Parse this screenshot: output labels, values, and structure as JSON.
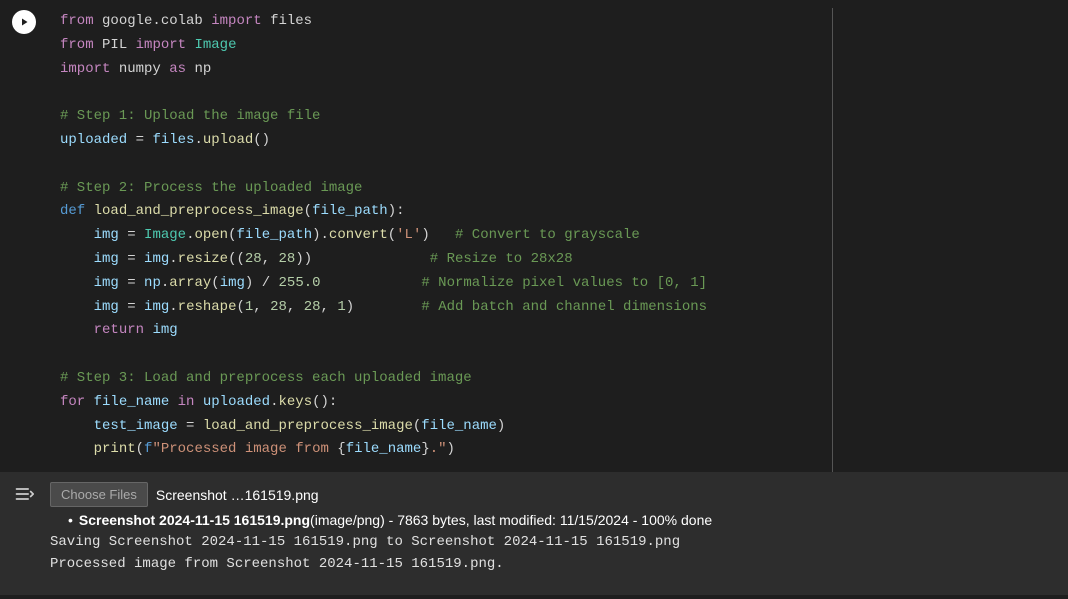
{
  "code": {
    "lines_html": [
      "<span class='kw'>from</span> <span class='mod'>google.colab</span> <span class='kw'>import</span> <span class='mod'>files</span>",
      "<span class='kw'>from</span> <span class='mod'>PIL</span> <span class='kw'>import</span> <span class='cls'>Image</span>",
      "<span class='kw'>import</span> <span class='mod'>numpy</span> <span class='kw'>as</span> <span class='mod'>np</span>",
      "",
      "<span class='cmt'># Step 1: Upload the image file</span>",
      "<span class='var'>uploaded</span> <span class='op'>=</span> <span class='var'>files</span><span class='punc'>.</span><span class='fn-call'>upload</span><span class='punc'>()</span>",
      "",
      "<span class='cmt'># Step 2: Process the uploaded image</span>",
      "<span class='kw-def'>def</span> <span class='fn'>load_and_preprocess_image</span><span class='punc'>(</span><span class='param'>file_path</span><span class='punc'>):</span>",
      "    <span class='var'>img</span> <span class='op'>=</span> <span class='cls'>Image</span><span class='punc'>.</span><span class='fn-call'>open</span><span class='punc'>(</span><span class='var'>file_path</span><span class='punc'>).</span><span class='fn-call'>convert</span><span class='punc'>(</span><span class='str'>'L'</span><span class='punc'>)</span>   <span class='cmt'># Convert to grayscale</span>",
      "    <span class='var'>img</span> <span class='op'>=</span> <span class='var'>img</span><span class='punc'>.</span><span class='fn-call'>resize</span><span class='punc'>((</span><span class='num'>28</span><span class='punc'>,</span> <span class='num'>28</span><span class='punc'>))</span>              <span class='cmt'># Resize to 28x28</span>",
      "    <span class='var'>img</span> <span class='op'>=</span> <span class='var'>np</span><span class='punc'>.</span><span class='fn-call'>array</span><span class='punc'>(</span><span class='var'>img</span><span class='punc'>)</span> <span class='op'>/</span> <span class='num'>255.0</span>            <span class='cmt'># Normalize pixel values to [0, 1]</span>",
      "    <span class='var'>img</span> <span class='op'>=</span> <span class='var'>img</span><span class='punc'>.</span><span class='fn-call'>reshape</span><span class='punc'>(</span><span class='num'>1</span><span class='punc'>,</span> <span class='num'>28</span><span class='punc'>,</span> <span class='num'>28</span><span class='punc'>,</span> <span class='num'>1</span><span class='punc'>)</span>        <span class='cmt'># Add batch and channel dimensions</span>",
      "    <span class='kw'>return</span> <span class='var'>img</span>",
      "",
      "<span class='cmt'># Step 3: Load and preprocess each uploaded image</span>",
      "<span class='kw'>for</span> <span class='var'>file_name</span> <span class='kw'>in</span> <span class='var'>uploaded</span><span class='punc'>.</span><span class='fn-call'>keys</span><span class='punc'>():</span>",
      "    <span class='var'>test_image</span> <span class='op'>=</span> <span class='fn-call'>load_and_preprocess_image</span><span class='punc'>(</span><span class='var'>file_name</span><span class='punc'>)</span>",
      "    <span class='fn-call'>print</span><span class='punc'>(</span><span class='kw-def'>f</span><span class='str'>\"Processed image from </span><span class='punc'>{</span><span class='var'>file_name</span><span class='punc'>}</span><span class='str'>.\"</span><span class='punc'>)</span>"
    ]
  },
  "output": {
    "choose_label": "Choose Files",
    "chosen_file": "Screenshot …161519.png",
    "upload_bold": "Screenshot 2024-11-15 161519.png",
    "upload_rest": "(image/png) - 7863 bytes, last modified: 11/15/2024 - 100% done",
    "saving_line": "Saving Screenshot 2024-11-15 161519.png to Screenshot 2024-11-15 161519.png",
    "processed_line": "Processed image from Screenshot 2024-11-15 161519.png."
  }
}
